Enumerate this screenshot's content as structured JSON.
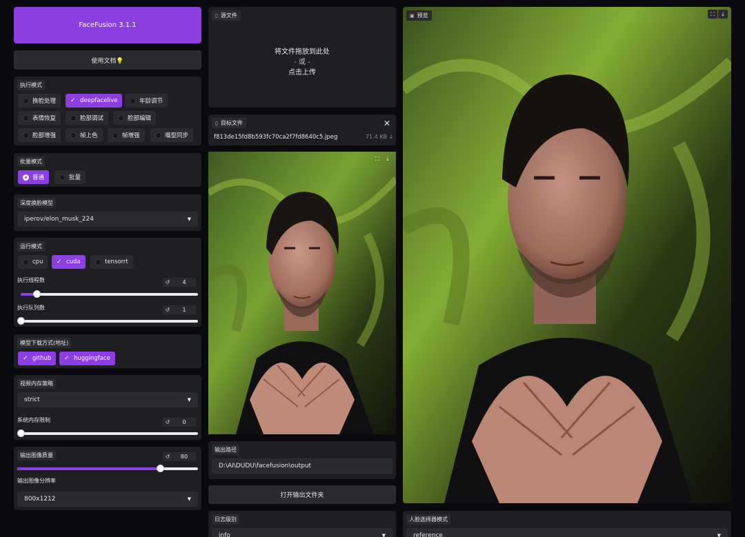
{
  "app": {
    "title": "FaceFusion 3.1.1",
    "docs_label": "使用文档💡"
  },
  "execution_mode": {
    "label": "执行模式",
    "options": [
      {
        "label": "换脸处理",
        "checked": false
      },
      {
        "label": "deepfacelive",
        "checked": true
      },
      {
        "label": "年龄调节",
        "checked": false
      },
      {
        "label": "表情恢复",
        "checked": false
      },
      {
        "label": "脸部调试",
        "checked": false
      },
      {
        "label": "脸部编辑",
        "checked": false
      },
      {
        "label": "脸部增强",
        "checked": false
      },
      {
        "label": "帧上色",
        "checked": false
      },
      {
        "label": "帧增强",
        "checked": false
      },
      {
        "label": "嘴型同步",
        "checked": false
      }
    ]
  },
  "batch_mode": {
    "label": "批量模式",
    "options": [
      {
        "label": "普通",
        "selected": true
      },
      {
        "label": "批量",
        "selected": false
      }
    ]
  },
  "deep_swap_model": {
    "label": "深度换脸模型",
    "value": "iperov/elon_musk_224"
  },
  "runtime": {
    "label": "运行模式",
    "options": [
      {
        "label": "cpu",
        "checked": false
      },
      {
        "label": "cuda",
        "checked": true
      },
      {
        "label": "tensorrt",
        "checked": false
      }
    ],
    "threads": {
      "label": "执行线程数",
      "value": "4",
      "fraction": 0.09
    },
    "queue": {
      "label": "执行队列数",
      "value": "1",
      "fraction": 0.0
    }
  },
  "download": {
    "label": "模型下载方式(地址)",
    "options": [
      {
        "label": "github",
        "checked": true
      },
      {
        "label": "huggingface",
        "checked": true
      }
    ]
  },
  "video_memory": {
    "label": "视频内存策略",
    "value": "strict",
    "system_memory": {
      "label": "系统内存限制",
      "value": "0",
      "fraction": 0.0
    }
  },
  "output_quality": {
    "label": "输出图像质量",
    "value": "80",
    "fraction": 0.79
  },
  "output_resolution": {
    "label": "输出图像分辨率",
    "value": "800x1212"
  },
  "source": {
    "label": "源文件",
    "drop_text": "将文件拖放到此处",
    "or_text": "- 或 -",
    "upload_text": "点击上传"
  },
  "target": {
    "label": "目标文件",
    "filename": "f813de15fd8b593fc70ca2f7fd8640c5.jpeg",
    "size": "71.4 KB ↓"
  },
  "output_path": {
    "label": "输出路径",
    "value": "D:\\AI\\DUDU\\facefusion\\output"
  },
  "open_output_button": "打开输出文件夹",
  "log_level": {
    "label": "日志级别",
    "value": "info"
  },
  "preview": {
    "label": "预览"
  },
  "face_selector": {
    "label": "人脸选择器模式",
    "value": "reference"
  },
  "icons": {
    "fullscreen": "fullscreen-icon",
    "download": "download-icon",
    "reset": "reset-icon",
    "check": "check-icon",
    "close": "close-icon",
    "file": "file-icon",
    "image": "image-icon",
    "chevron": "chevron-down-icon"
  },
  "colors": {
    "accent": "#8b3fe0",
    "panel": "#1f1f23",
    "background": "#0b0b0f",
    "field": "#2a2a2f"
  }
}
